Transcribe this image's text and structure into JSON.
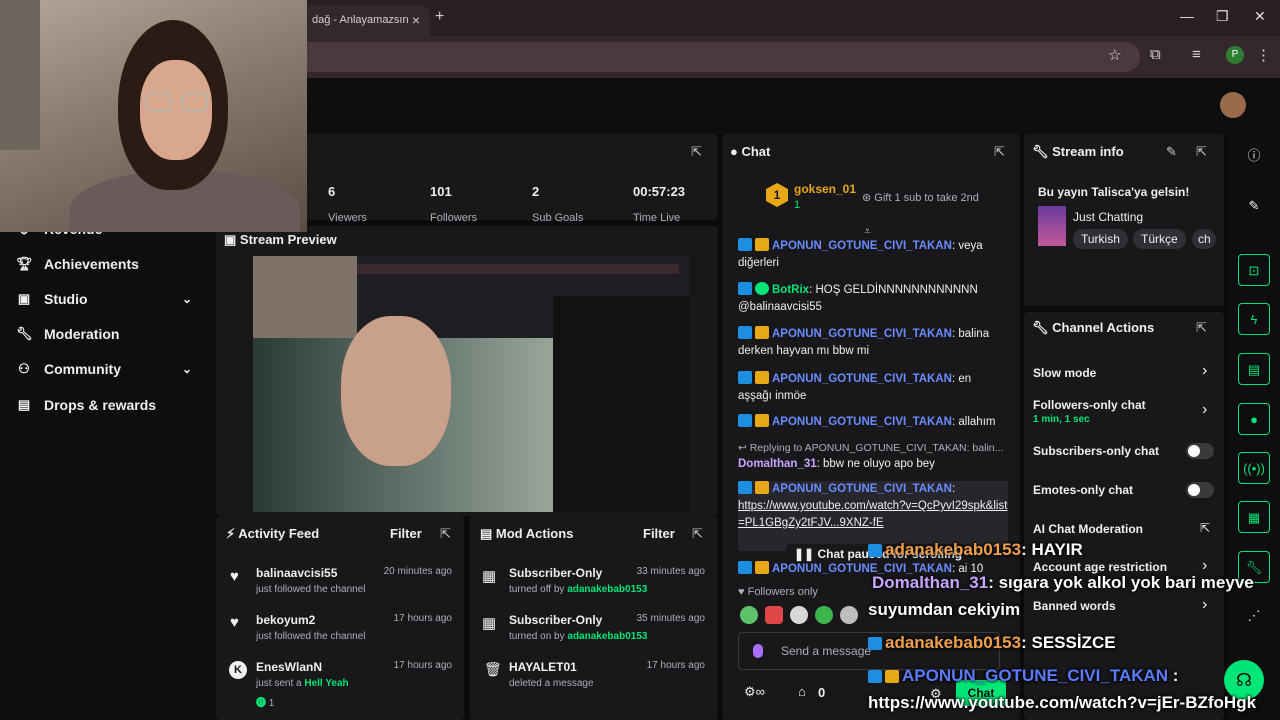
{
  "browser": {
    "tab_title": "dağ - Anlayamazsın",
    "tab_close": "×",
    "new_tab": "+",
    "profile_letter": "P"
  },
  "sidebar": {
    "items": [
      {
        "label": "Revenue",
        "icon": "dollar-icon"
      },
      {
        "label": "Achievements",
        "icon": "trophy-icon"
      },
      {
        "label": "Studio",
        "icon": "studio-icon"
      },
      {
        "label": "Moderation",
        "icon": "wrench-icon"
      },
      {
        "label": "Community",
        "icon": "users-icon"
      },
      {
        "label": "Drops & rewards",
        "icon": "gift-icon"
      }
    ]
  },
  "stats": {
    "viewers": "6",
    "viewers_label": "Viewers",
    "followers": "101",
    "followers_label": "Followers",
    "subs": "2",
    "subs_label": "Sub Goals",
    "time": "00:57:23",
    "time_label": "Time Live"
  },
  "stream_preview": {
    "title": "Stream Preview"
  },
  "activity_feed": {
    "title": "Activity Feed",
    "filter": "Filter",
    "items": [
      {
        "name": "balinaavcisi55",
        "sub": "just followed the channel",
        "time": "20 minutes ago"
      },
      {
        "name": "bekoyum2",
        "sub": "just followed the channel",
        "time": "17 hours ago"
      },
      {
        "name": "EnesWlanN",
        "sub": "just sent a",
        "extra": "Hell Yeah",
        "count": "1",
        "time": "17 hours ago"
      }
    ]
  },
  "mod_actions": {
    "title": "Mod Actions",
    "filter": "Filter",
    "items": [
      {
        "name": "Subscriber-Only",
        "sub": "turned off by",
        "by": "adanakebab0153",
        "time": "33 minutes ago"
      },
      {
        "name": "Subscriber-Only",
        "sub": "turned on by",
        "by": "adanakebab0153",
        "time": "35 minutes ago"
      },
      {
        "name": "HAYALET01",
        "sub": "deleted a message",
        "time": "17 hours ago"
      }
    ]
  },
  "chat": {
    "title": "Chat",
    "gifter": "goksen_01",
    "gifter_rank": "1",
    "gifter_count": "1",
    "gift_text": "Gift 1 sub to take 2nd",
    "messages": [
      {
        "user": "APONUN_GOTUNE_CIVI_TAKAN",
        "sep": ":",
        "text": "veya diğerleri"
      },
      {
        "user": "BotRix",
        "sep": ":",
        "text": "HOŞ GELDİNNNNNNNNNNNN @balinaavcisi55"
      },
      {
        "user": "APONUN_GOTUNE_CIVI_TAKAN",
        "sep": ":",
        "text": "balina derken hayvan mı bbw mi"
      },
      {
        "user": "APONUN_GOTUNE_CIVI_TAKAN",
        "sep": ":",
        "text": "en aşşağı inmöe"
      },
      {
        "user": "APONUN_GOTUNE_CIVI_TAKAN",
        "sep": ":",
        "text": "allahım"
      }
    ],
    "reply_note": "Replying to APONUN_GOTUNE_CIVI_TAKAN: balin...",
    "reply_user": "Domalthan_31",
    "reply_text": "bbw ne oluyo apo bey",
    "link_user": "APONUN_GOTUNE_CIVI_TAKAN",
    "link_text": "https://www.youtube.com/watch?v=QcPyvI29spk&list=PL1GBgZy2tFJV...9XNZ-fE",
    "last_user": "APONUN_GOTUNE_CIVI_TAKAN",
    "last_text": "ai 10",
    "paused": "Chat paused for scrolling",
    "followers_only": "Followers only",
    "send_placeholder": "Send a message",
    "counter": "0",
    "chat_button": "Chat"
  },
  "stream_info": {
    "title": "Stream info",
    "stream_title": "Bu yayın Talisca'ya gelsin!",
    "category": "Just Chatting",
    "tags": [
      "Turkish",
      "Türkçe",
      "ch"
    ]
  },
  "channel_actions": {
    "title": "Channel Actions",
    "rows": [
      {
        "label": "Slow mode"
      },
      {
        "label": "Followers-only chat",
        "sub": "1 min, 1 sec"
      },
      {
        "label": "Subscribers-only chat"
      },
      {
        "label": "Emotes-only chat"
      },
      {
        "label": "AI Chat Moderation"
      },
      {
        "label": "Account age restriction"
      },
      {
        "label": "Banned words"
      }
    ]
  },
  "overlay": {
    "line1_user": "adanakebab0153",
    "line1_text": ": HAYIR",
    "line2_user": "Domalthan_31",
    "line2_text": ": sıgara yok alkol yok bari meyve",
    "line2b_text": "suyumdan cekiyim",
    "line3_user": "adanakebab0153",
    "line3_text": ": SESSİZCE",
    "line4_user": "APONUN_GOTUNE_CIVI_TAKAN",
    "line4_sep": ":",
    "line4_text": "https://www.youtube.com/watch?v=jEr-BZfoHgk"
  },
  "colors": {
    "accent_green": "#00e676",
    "chat_name": "#6b8cff",
    "panel_bg": "#18181b"
  }
}
